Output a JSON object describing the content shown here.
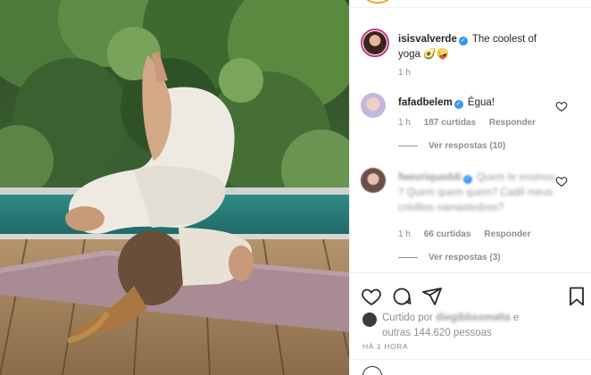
{
  "post": {
    "caption": {
      "username": "isisvalverde",
      "text": "The coolest of yoga",
      "emojis": "🥑🤪",
      "time": "1 h"
    }
  },
  "comments": [
    {
      "username": "fafadbelem",
      "text": "Égua!",
      "time": "1 h",
      "likes": "187 curtidas",
      "reply_label": "Responder",
      "view_replies": "Ver respostas (10)"
    },
    {
      "username": "fwevriqueddi",
      "text": "Quem te ensinou ? Quem quem quem? Cadê meus créditos namastedoss?",
      "time": "1 h",
      "likes": "66 curtidas",
      "reply_label": "Responder",
      "view_replies": "Ver respostas (3)"
    }
  ],
  "likes_summary": {
    "prefix": "Curtido por",
    "liker": "diegibbssmalta",
    "connector": "e",
    "others": "outras 144.620 pessoas"
  },
  "timestamp": "HÁ 1 HORA",
  "icons": {
    "like": "heart-icon",
    "comment": "comment-icon",
    "share": "share-icon",
    "save": "bookmark-icon",
    "verified": "verified-badge-icon"
  },
  "colors": {
    "verified": "#3897f0",
    "muted": "#8e8e8e",
    "text": "#262626"
  }
}
